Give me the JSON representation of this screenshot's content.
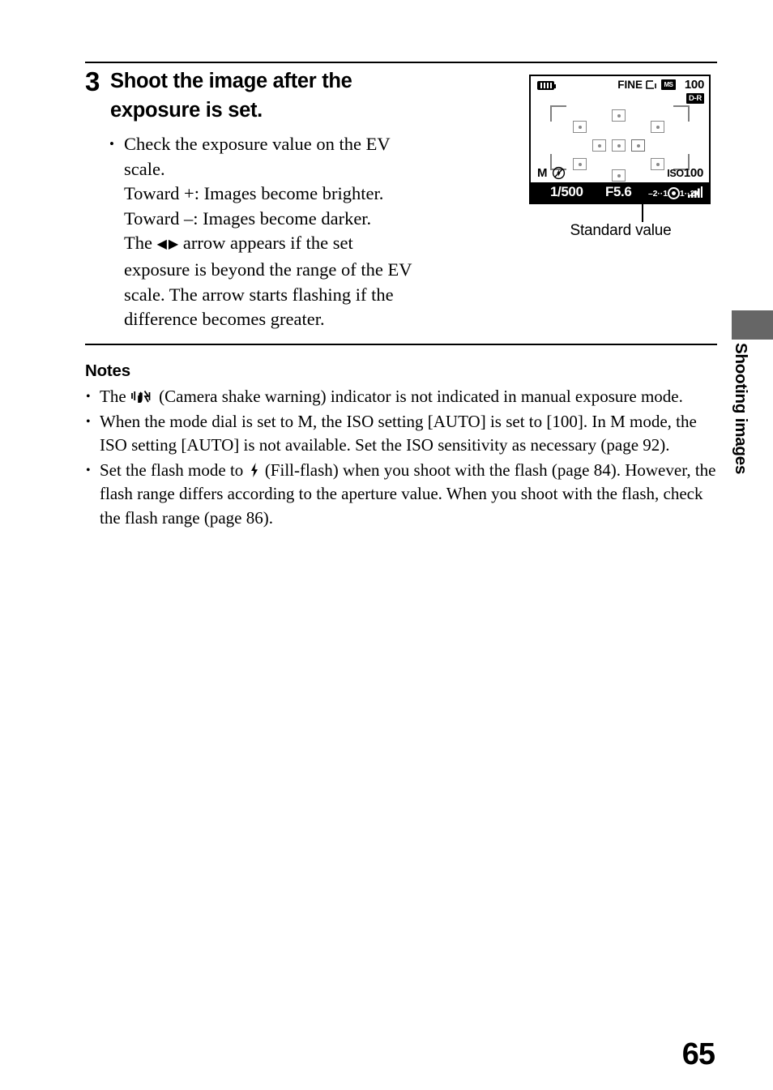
{
  "step": {
    "number": "3",
    "title": "Shoot the image after the exposure is set.",
    "bullet_lines": [
      "Check the exposure value on the EV scale.",
      "Toward +: Images become brighter.",
      "Toward –: Images become darker.",
      "The ◀ ▶ arrow appears if the set exposure is beyond the range of the EV scale. The arrow starts flashing if the difference becomes greater."
    ],
    "bullet_line_1": "Check the exposure value on the EV",
    "bullet_line_2": "scale.",
    "bullet_line_3": "Toward +: Images become brighter.",
    "bullet_line_4": "Toward –: Images become darker.",
    "bullet_line_5_pre": "The",
    "bullet_line_5_post": "arrow appears if the set",
    "bullet_line_6": "exposure is beyond the range of the EV",
    "bullet_line_7": "scale. The arrow starts flashing if the",
    "bullet_line_8": "difference becomes greater.",
    "arrow_left": "◀",
    "arrow_right": "▶"
  },
  "notes": {
    "heading": "Notes",
    "items": [
      {
        "pre": "The",
        "icon": "camera-shake-warning-icon",
        "post": "(Camera shake warning) indicator is not indicated in manual exposure mode."
      },
      {
        "text": "When the mode dial is set to M, the ISO setting [AUTO] is set to [100]. In M mode, the ISO setting [AUTO] is not available. Set the ISO sensitivity as necessary (page 92)."
      },
      {
        "pre": "Set the flash mode to",
        "icon": "flash-bolt-icon",
        "post": "(Fill-flash) when you shoot with the flash (page 84). However, the flash range differs according to the aperture value. When you shoot with the flash, check the flash range (page 86)."
      }
    ]
  },
  "lcd": {
    "battery_icon": "battery-icon",
    "quality": "FINE",
    "image_size_icon": "image-size-icon",
    "card_icon": "memory-card-icon",
    "card_icon_text": "MS",
    "shots_remaining": "100",
    "dro_badge": "D-R",
    "mode": "M",
    "flash_off_icon": "flash-off-icon",
    "iso_prefix": "ISO",
    "iso_value": "100",
    "shutter_speed": "1/500",
    "aperture": "F5.6",
    "ev_scale_left": "–2",
    "ev_scale_left_dots": "··",
    "ev_scale_left_one": "1",
    "ev_scale_right_one": "1",
    "ev_scale_right_dots": "··",
    "ev_scale_right": "2+",
    "ev_indicator": "ev-standard-value-indicator",
    "signal_icon": "signal-bars-icon",
    "callout_label": "Standard value",
    "af_points": 9
  },
  "chapter_tab": {
    "label": "Shooting images",
    "mark_color": "#666666"
  },
  "page_number": "65"
}
